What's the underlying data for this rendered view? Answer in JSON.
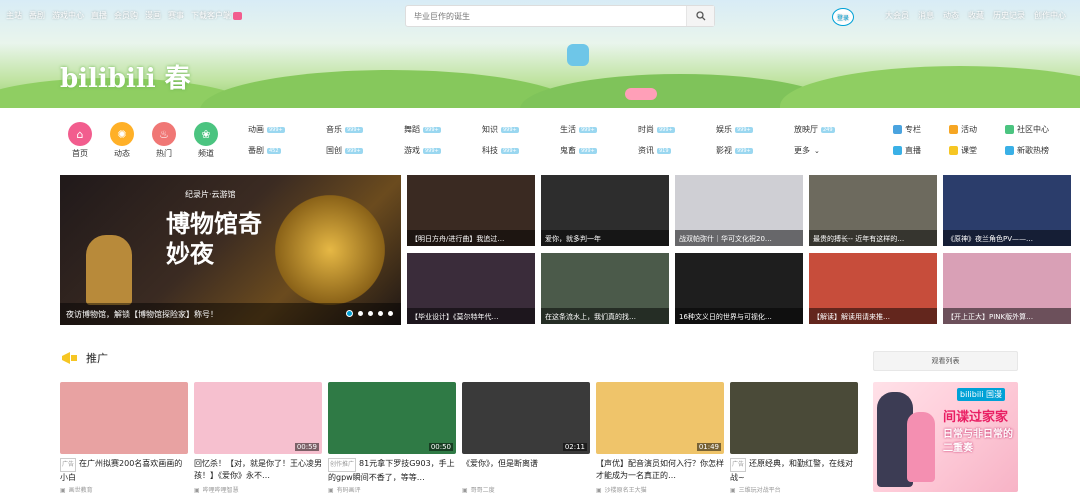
{
  "topnav": {
    "left": [
      "主站",
      "番剧",
      "游戏中心",
      "直播",
      "会员购",
      "漫画",
      "赛事",
      "下载客户端"
    ],
    "login": "登录",
    "right": [
      "大会员",
      "消息",
      "动态",
      "收藏",
      "历史记录",
      "创作中心"
    ]
  },
  "search": {
    "placeholder": "毕业巨作的诞生"
  },
  "banner": {
    "logo": "bilibili 春"
  },
  "quick": [
    {
      "label": "首页",
      "color": "#f25d8e",
      "glyph": "⌂"
    },
    {
      "label": "动态",
      "color": "#ffb027",
      "glyph": "✺"
    },
    {
      "label": "热门",
      "color": "#f07775",
      "glyph": "♨"
    },
    {
      "label": "频道",
      "color": "#4bc480",
      "glyph": "❀"
    }
  ],
  "categories": [
    {
      "name": "动画",
      "n": "999+"
    },
    {
      "name": "音乐",
      "n": "999+"
    },
    {
      "name": "舞蹈",
      "n": "999+"
    },
    {
      "name": "知识",
      "n": "999+"
    },
    {
      "name": "生活",
      "n": "999+"
    },
    {
      "name": "时尚",
      "n": "999+"
    },
    {
      "name": "娱乐",
      "n": "999+"
    },
    {
      "name": "放映厅",
      "n": "249"
    },
    {
      "name": "番剧",
      "n": "452"
    },
    {
      "name": "国创",
      "n": "999+"
    },
    {
      "name": "游戏",
      "n": "999+"
    },
    {
      "name": "科技",
      "n": "999+"
    },
    {
      "name": "鬼畜",
      "n": "999+"
    },
    {
      "name": "资讯",
      "n": "919"
    },
    {
      "name": "影视",
      "n": "999+"
    },
    {
      "name": "更多",
      "n": ""
    }
  ],
  "right_links": [
    {
      "label": "专栏",
      "color": "#4aa3df"
    },
    {
      "label": "活动",
      "color": "#f6a623"
    },
    {
      "label": "社区中心",
      "color": "#4bc480"
    },
    {
      "label": "直播",
      "color": "#3ab0e6"
    },
    {
      "label": "课堂",
      "color": "#f6c623"
    },
    {
      "label": "新歌热榜",
      "color": "#3ab0e6"
    }
  ],
  "carousel": {
    "overlay_top": "纪录片·云游馆",
    "overlay_main": "博物馆奇妙夜",
    "caption": "夜访博物馆，解锁【博物馆探险家】称号！"
  },
  "tiles": [
    {
      "caption": "【明日方舟/进行曲】我追过…",
      "bg": "#3a2a22"
    },
    {
      "caption": "爱你，就多判一年",
      "bg": "#2d2d2d"
    },
    {
      "caption": "战双帕弥什｜华可文化祝20…",
      "bg": "#cfcfd4"
    },
    {
      "caption": "最贵的搏长-- 近年有这样的…",
      "bg": "#6d6a5e"
    },
    {
      "caption": "《原神》夜兰角色PV——…",
      "bg": "#2b3d6b"
    },
    {
      "caption": "【毕业设计】《莫尔特年代…",
      "bg": "#3a2c3a"
    },
    {
      "caption": "在这条流水上，我们真的找…",
      "bg": "#4b5a4a"
    },
    {
      "caption": "16种文义日的世界与可视化…",
      "bg": "#1e1e1e"
    },
    {
      "caption": "【解读】解读用请来推…",
      "bg": "#c74d3b"
    },
    {
      "caption": "【开上正大】PINK版外算…",
      "bg": "#d9a0b6"
    }
  ],
  "section": {
    "title": "推广",
    "rank_btn": "观看列表"
  },
  "cards": [
    {
      "title": "在广州拟赛200名喜欢画画的小白",
      "ad": "广告",
      "up": "画世教育",
      "dur": "",
      "bg": "#e8a2a2"
    },
    {
      "title": "回忆杀！【对，就是你了！王心凌男孩！】《爱你》永不…",
      "ad": "",
      "up": "哔哩哔哩智慧",
      "dur": "00:59",
      "bg": "#f6c0cf"
    },
    {
      "title": "81元拿下罗技G903，手上的gpw瞬间不香了，等等…",
      "ad": "创作推广",
      "up": "有码画评",
      "dur": "00:50",
      "bg": "#2f7a45"
    },
    {
      "title": "《爱你》，但是断离谱",
      "ad": "",
      "up": "哥哥二度",
      "dur": "02:11",
      "bg": "#3a3a3a"
    },
    {
      "title": "【声优】配音演员如何入行？你怎样才能成为一名真正的…",
      "ad": "",
      "up": "沙楼原名王大猫",
      "dur": "01:49",
      "bg": "#efc46a"
    },
    {
      "title": "还原经典，和勤红警，在线对战~",
      "ad": "广告",
      "up": "三维玩对战平台",
      "dur": "",
      "bg": "#4a4a38"
    }
  ],
  "bigad": {
    "title": "间谍过家家",
    "sub": "日常与非日常的二重奏",
    "brand": "bilibili 国漫"
  }
}
